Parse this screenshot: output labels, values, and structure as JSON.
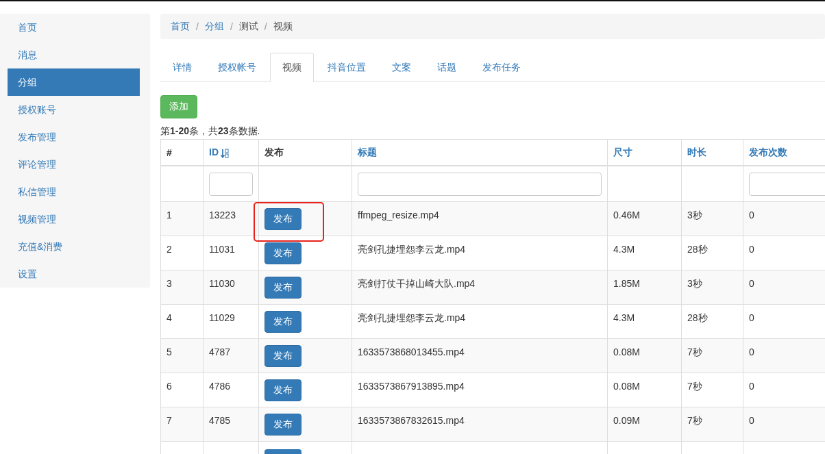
{
  "sidebar": {
    "items": [
      {
        "label": "首页",
        "selected": false
      },
      {
        "label": "消息",
        "selected": false
      },
      {
        "label": "分组",
        "selected": true
      },
      {
        "label": "授权账号",
        "selected": false
      },
      {
        "label": "发布管理",
        "selected": false
      },
      {
        "label": "评论管理",
        "selected": false
      },
      {
        "label": "私信管理",
        "selected": false
      },
      {
        "label": "视频管理",
        "selected": false
      },
      {
        "label": "充值&消费",
        "selected": false
      },
      {
        "label": "设置",
        "selected": false
      }
    ]
  },
  "breadcrumb": {
    "separator": "/",
    "items": [
      {
        "label": "首页",
        "kind": "link"
      },
      {
        "label": "分组",
        "kind": "link"
      },
      {
        "label": "测试",
        "kind": "text"
      },
      {
        "label": "视频",
        "kind": "text"
      }
    ]
  },
  "tabs": [
    {
      "label": "详情",
      "selected": false
    },
    {
      "label": "授权帐号",
      "selected": false
    },
    {
      "label": "视频",
      "selected": true
    },
    {
      "label": "抖音位置",
      "selected": false
    },
    {
      "label": "文案",
      "selected": false
    },
    {
      "label": "话题",
      "selected": false
    },
    {
      "label": "发布任务",
      "selected": false
    }
  ],
  "add_button": "添加",
  "summary": "第**1-20**条，共**23**条数据.",
  "table": {
    "columns": [
      {
        "label": "#",
        "kind": "plain",
        "filter": false
      },
      {
        "label": "ID",
        "kind": "sorted",
        "filter": true
      },
      {
        "label": "发布",
        "kind": "plain",
        "filter": false
      },
      {
        "label": "标题",
        "kind": "link",
        "filter": true
      },
      {
        "label": "尺寸",
        "kind": "link",
        "filter": false
      },
      {
        "label": "时长",
        "kind": "link",
        "filter": false
      },
      {
        "label": "发布次数",
        "kind": "link",
        "filter": true
      }
    ],
    "rows": [
      {
        "num": "1",
        "id": "13223",
        "action": "发布",
        "title": "ffmpeg_resize.mp4",
        "size": "0.46M",
        "duration": "3秒",
        "count": "0",
        "highlighted": true
      },
      {
        "num": "2",
        "id": "11031",
        "action": "发布",
        "title": "亮剑孔捷埋怨李云龙.mp4",
        "size": "4.3M",
        "duration": "28秒",
        "count": "0",
        "highlighted": false
      },
      {
        "num": "3",
        "id": "11030",
        "action": "发布",
        "title": "亮剑打仗干掉山崎大队.mp4",
        "size": "1.85M",
        "duration": "3秒",
        "count": "0",
        "highlighted": false
      },
      {
        "num": "4",
        "id": "11029",
        "action": "发布",
        "title": "亮剑孔捷埋怨李云龙.mp4",
        "size": "4.3M",
        "duration": "28秒",
        "count": "0",
        "highlighted": false
      },
      {
        "num": "5",
        "id": "4787",
        "action": "发布",
        "title": "1633573868013455.mp4",
        "size": "0.08M",
        "duration": "7秒",
        "count": "0",
        "highlighted": false
      },
      {
        "num": "6",
        "id": "4786",
        "action": "发布",
        "title": "1633573867913895.mp4",
        "size": "0.08M",
        "duration": "7秒",
        "count": "0",
        "highlighted": false
      },
      {
        "num": "7",
        "id": "4785",
        "action": "发布",
        "title": "1633573867832615.mp4",
        "size": "0.09M",
        "duration": "7秒",
        "count": "0",
        "highlighted": false
      }
    ]
  }
}
